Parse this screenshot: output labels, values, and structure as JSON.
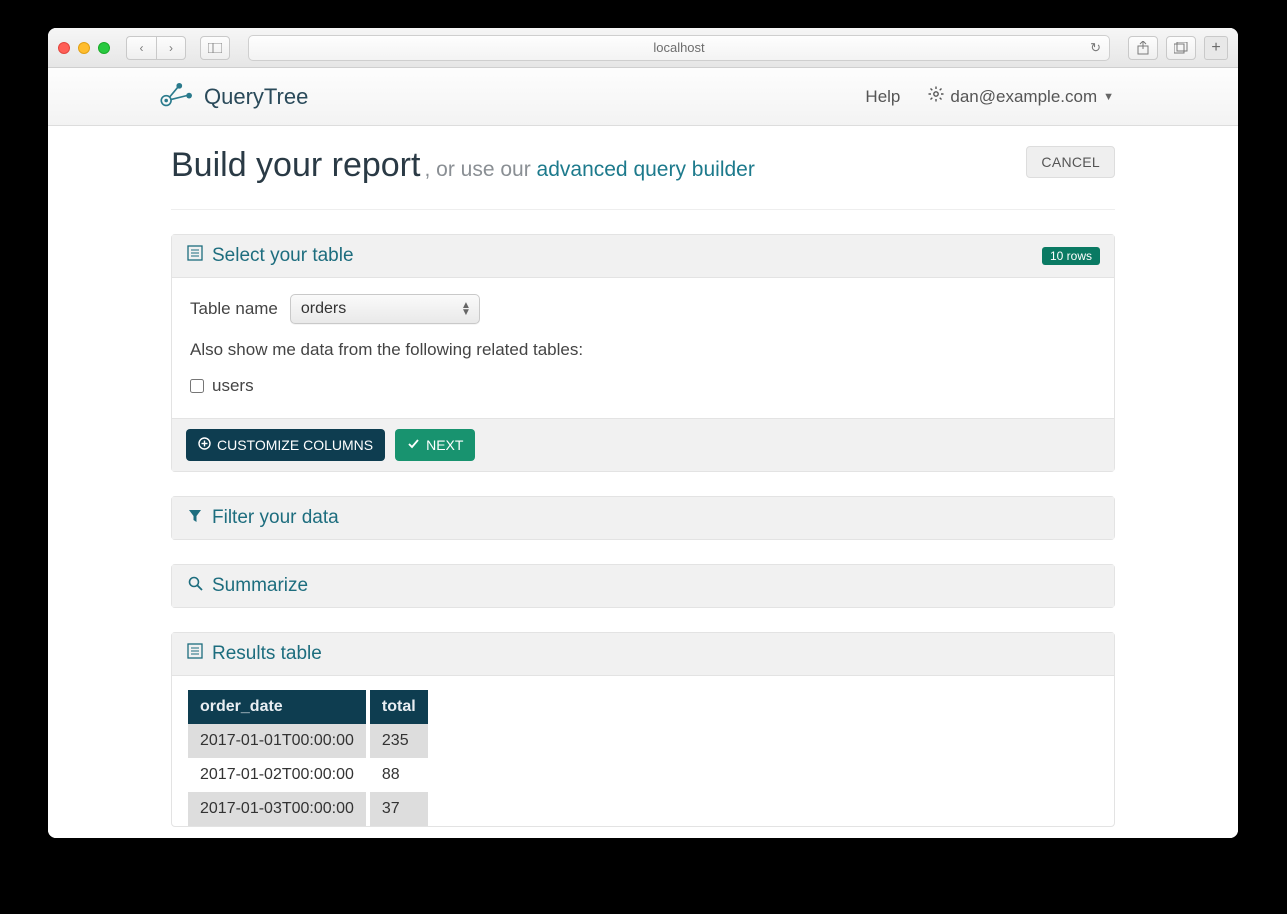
{
  "browser": {
    "url": "localhost"
  },
  "header": {
    "brand": "QueryTree",
    "help": "Help",
    "user": "dan@example.com"
  },
  "page": {
    "title": "Build your report",
    "subtitle_prefix": ", or use our ",
    "subtitle_link": "advanced query builder",
    "cancel": "CANCEL"
  },
  "panels": {
    "select_table": {
      "title": "Select your table",
      "badge": "10 rows",
      "table_label": "Table name",
      "table_value": "orders",
      "related_hint": "Also show me data from the following related tables:",
      "related_options": [
        "users"
      ],
      "customize_btn": "CUSTOMIZE COLUMNS",
      "next_btn": "NEXT"
    },
    "filter": {
      "title": "Filter your data"
    },
    "summarize": {
      "title": "Summarize"
    },
    "results": {
      "title": "Results table",
      "columns": [
        "order_date",
        "total"
      ],
      "rows": [
        [
          "2017-01-01T00:00:00",
          "235"
        ],
        [
          "2017-01-02T00:00:00",
          "88"
        ],
        [
          "2017-01-03T00:00:00",
          "37"
        ]
      ]
    }
  }
}
